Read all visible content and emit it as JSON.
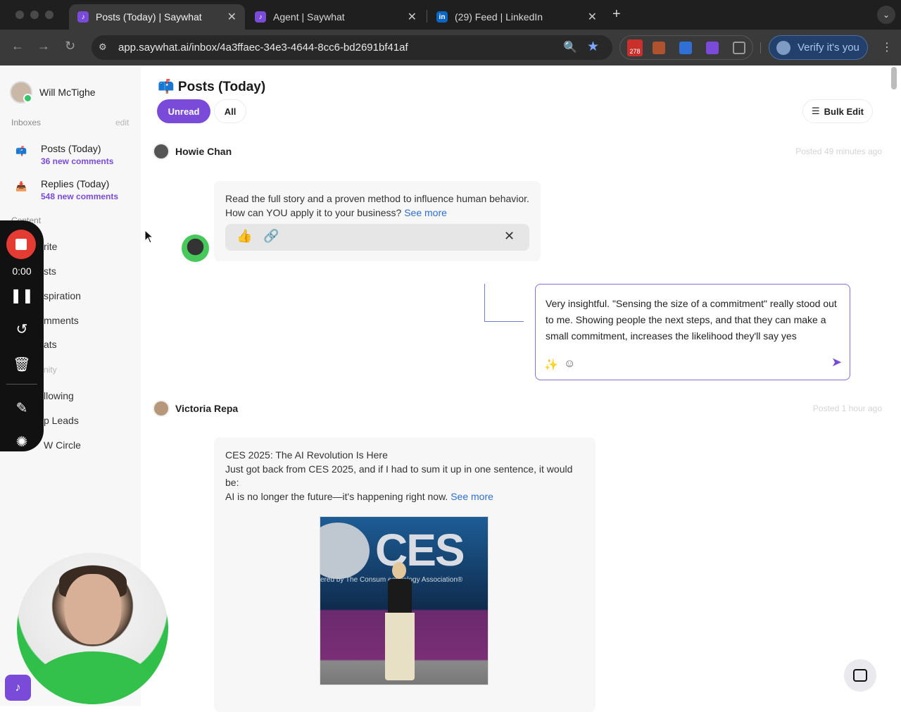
{
  "browser": {
    "tabs": [
      {
        "label": "Posts (Today) | Saywhat",
        "favicon": "saywhat-icon",
        "active": true
      },
      {
        "label": "Agent | Saywhat",
        "favicon": "saywhat-icon",
        "active": false
      },
      {
        "label": "(29) Feed | LinkedIn",
        "favicon": "linkedin-icon",
        "active": false
      }
    ],
    "url": "app.saywhat.ai/inbox/4a3ffaec-34e3-4644-8cc6-bd2691bf41af",
    "extension_badge": "278",
    "verify_label": "Verify it's you"
  },
  "sidebar": {
    "user_name": "Will McTighe",
    "inboxes_label": "Inboxes",
    "edit_label": "edit",
    "inboxes": [
      {
        "title": "Posts (Today)",
        "sub": "36 new comments"
      },
      {
        "title": "Replies (Today)",
        "sub": "548 new comments"
      }
    ],
    "content_label": "Content",
    "content_links": [
      "rite",
      "sts",
      "spiration",
      "mments",
      "ats"
    ],
    "community_label": "nity",
    "community_links": [
      "llowing",
      "p Leads",
      "W Circle"
    ]
  },
  "recorder": {
    "time": "0:00"
  },
  "main": {
    "title": "📫 Posts (Today)",
    "filters": {
      "unread": "Unread",
      "all": "All"
    },
    "bulk_edit": "Bulk Edit",
    "posts": [
      {
        "author": "Howie Chan",
        "time": "Posted 49 minutes ago",
        "lines": [
          "Read the full story and a proven method to influence human behavior.",
          "How can YOU apply it to your business?"
        ],
        "see_more": "See more"
      },
      {
        "author": "Victoria Repa",
        "time": "Posted 1 hour ago",
        "lines": [
          "CES 2025: The AI Revolution Is Here",
          "Just got back from CES 2025, and if I had to sum it up in one sentence, it would",
          "be:",
          "AI is no longer the future—it's happening right now."
        ],
        "see_more": "See more",
        "image_text": "CES",
        "image_caption": "ered by The Consum  echnology Association®"
      }
    ],
    "reply_draft": "Very insightful. \"Sensing the size of a commitment\" really stood out to me. Showing people the next steps, and that they can make a small commitment, increases the likelihood they'll say yes"
  },
  "colors": {
    "accent": "#7a4bd9",
    "link": "#2d6fce"
  }
}
